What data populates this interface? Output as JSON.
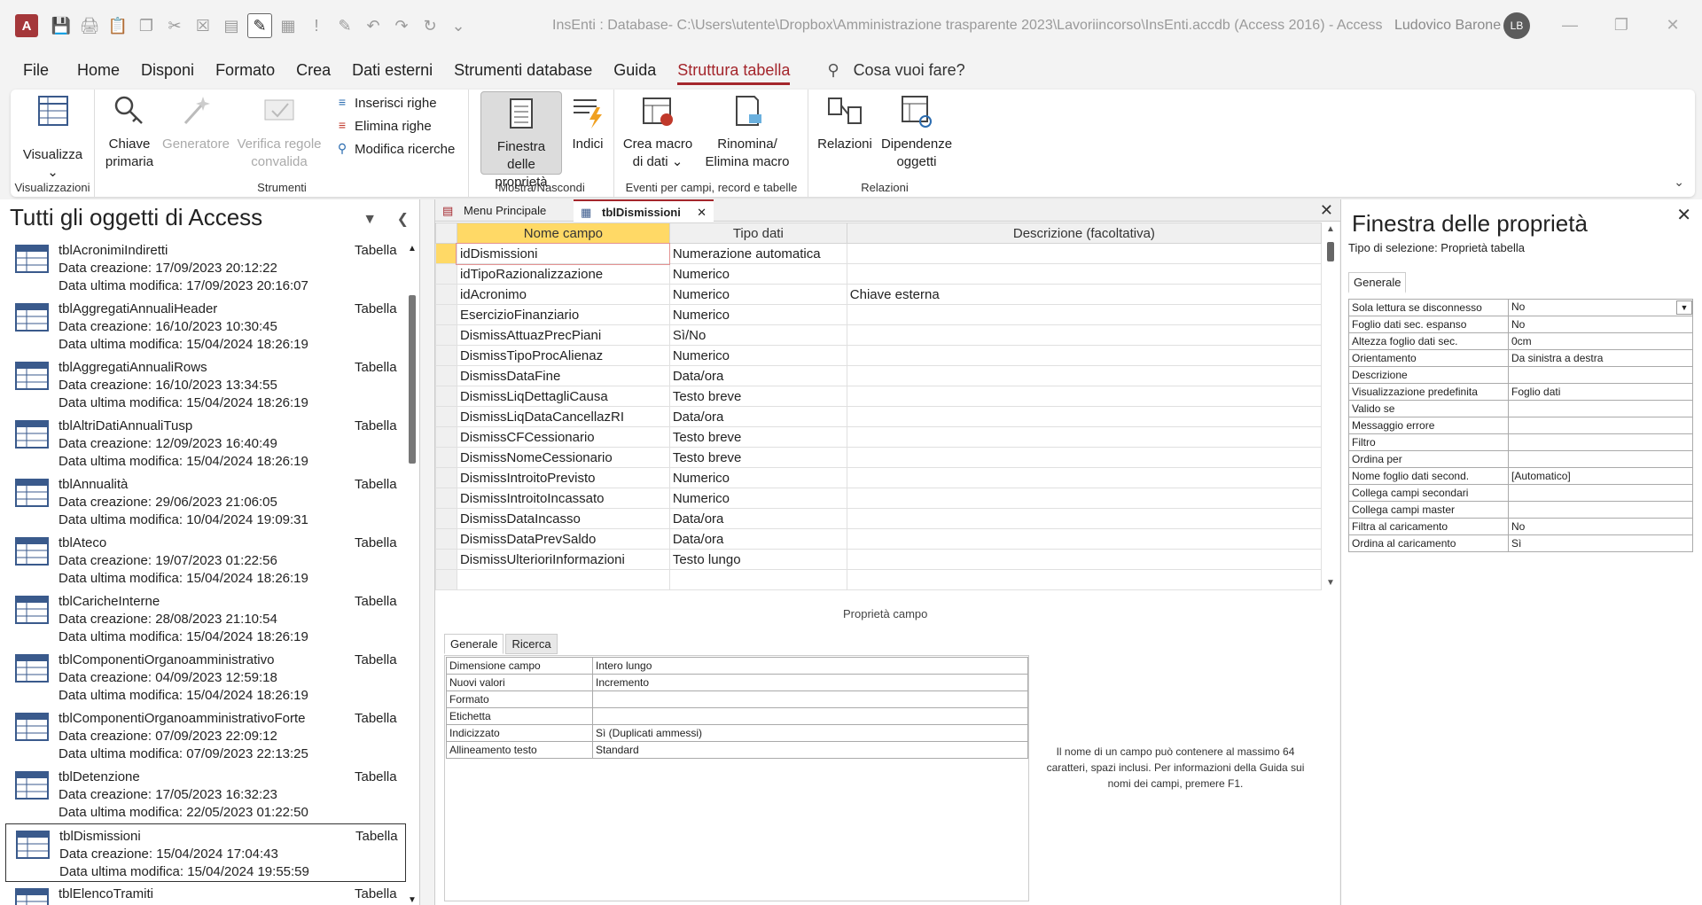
{
  "window": {
    "title": "InsEnti : Database- C:\\Users\\utente\\Dropbox\\Amministrazione trasparente 2023\\Lavoriincorso\\InsEnti.accdb (Access 2016)  -  Access",
    "user": "Ludovico Barone",
    "avatar_initials": "LB",
    "app_logo": "A"
  },
  "menu": {
    "items": [
      "File",
      "Home",
      "Disponi",
      "Formato",
      "Crea",
      "Dati esterni",
      "Strumenti database",
      "Guida",
      "Struttura tabella"
    ],
    "tellme": "Cosa vuoi fare?"
  },
  "ribbon": {
    "visualizza": "Visualizza",
    "visualizzazioni_group": "Visualizzazioni",
    "chiave_l1": "Chiave",
    "chiave_l2": "primaria",
    "generatore": "Generatore",
    "verifica_l1": "Verifica regole",
    "verifica_l2": "convalida",
    "inserisci_righe": "Inserisci righe",
    "elimina_righe": "Elimina righe",
    "modifica_ricerche": "Modifica ricerche",
    "strumenti_group": "Strumenti",
    "finestra_l1": "Finestra delle",
    "finestra_l2": "proprietà",
    "indici": "Indici",
    "mostra_group": "Mostra/Nascondi",
    "crea_macro_l1": "Crea macro",
    "crea_macro_l2": "di dati",
    "rinomina_l1": "Rinomina/",
    "rinomina_l2": "Elimina macro",
    "eventi_group": "Eventi per campi, record e tabelle",
    "relazioni": "Relazioni",
    "dipendenze_l1": "Dipendenze",
    "dipendenze_l2": "oggetti",
    "relazioni_group": "Relazioni"
  },
  "nav": {
    "title": "Tutti gli oggetti di Access",
    "items": [
      {
        "name": "tblAcronimiIndiretti",
        "created": "Data creazione: 17/09/2023 20:12:22",
        "modified": "Data ultima modifica: 17/09/2023 20:16:07",
        "type": "Tabella"
      },
      {
        "name": "tblAggregatiAnnualiHeader",
        "created": "Data creazione: 16/10/2023 10:30:45",
        "modified": "Data ultima modifica: 15/04/2024 18:26:19",
        "type": "Tabella"
      },
      {
        "name": "tblAggregatiAnnualiRows",
        "created": "Data creazione: 16/10/2023 13:34:55",
        "modified": "Data ultima modifica: 15/04/2024 18:26:19",
        "type": "Tabella"
      },
      {
        "name": "tblAltriDatiAnnualiTusp",
        "created": "Data creazione: 12/09/2023 16:40:49",
        "modified": "Data ultima modifica: 15/04/2024 18:26:19",
        "type": "Tabella"
      },
      {
        "name": "tblAnnualità",
        "created": "Data creazione: 29/06/2023 21:06:05",
        "modified": "Data ultima modifica: 10/04/2024 19:09:31",
        "type": "Tabella"
      },
      {
        "name": "tblAteco",
        "created": "Data creazione: 19/07/2023 01:22:56",
        "modified": "Data ultima modifica: 15/04/2024 18:26:19",
        "type": "Tabella"
      },
      {
        "name": "tblCaricheInterne",
        "created": "Data creazione: 28/08/2023 21:10:54",
        "modified": "Data ultima modifica: 15/04/2024 18:26:19",
        "type": "Tabella"
      },
      {
        "name": "tblComponentiOrganoamministrativo",
        "created": "Data creazione: 04/09/2023 12:59:18",
        "modified": "Data ultima modifica: 15/04/2024 18:26:19",
        "type": "Tabella"
      },
      {
        "name": "tblComponentiOrganoamministrativoForte",
        "created": "Data creazione: 07/09/2023 22:09:12",
        "modified": "Data ultima modifica: 07/09/2023 22:13:25",
        "type": "Tabella"
      },
      {
        "name": "tblDetenzione",
        "created": "Data creazione: 17/05/2023 16:32:23",
        "modified": "Data ultima modifica: 22/05/2023 01:22:50",
        "type": "Tabella"
      },
      {
        "name": "tblDismissioni",
        "created": "Data creazione: 15/04/2024 17:04:43",
        "modified": "Data ultima modifica: 15/04/2024 19:55:59",
        "type": "Tabella"
      },
      {
        "name": "tblElencoTramiti",
        "created": "",
        "modified": "",
        "type": "Tabella"
      }
    ]
  },
  "doc": {
    "tabs": [
      "Menu Principale",
      "tblDismissioni"
    ],
    "headers": [
      "Nome campo",
      "Tipo dati",
      "Descrizione (facoltativa)"
    ],
    "rows": [
      [
        "idDismissioni",
        "Numerazione automatica",
        ""
      ],
      [
        "idTipoRazionalizzazione",
        "Numerico",
        ""
      ],
      [
        "idAcronimo",
        "Numerico",
        "Chiave esterna"
      ],
      [
        "EsercizioFinanziario",
        "Numerico",
        ""
      ],
      [
        "DismissAttuazPrecPiani",
        "Sì/No",
        ""
      ],
      [
        "DismissTipoProcAlienaz",
        "Numerico",
        ""
      ],
      [
        "DismissDataFine",
        "Data/ora",
        ""
      ],
      [
        "DismissLiqDettagliCausa",
        "Testo breve",
        ""
      ],
      [
        "DismissLiqDataCancellazRI",
        "Data/ora",
        ""
      ],
      [
        "DismissCFCessionario",
        "Testo breve",
        ""
      ],
      [
        "DismissNomeCessionario",
        "Testo breve",
        ""
      ],
      [
        "DismissIntroitoPrevisto",
        "Numerico",
        ""
      ],
      [
        "DismissIntroitoIncassato",
        "Numerico",
        ""
      ],
      [
        "DismissDataIncasso",
        "Data/ora",
        ""
      ],
      [
        "DismissDataPrevSaldo",
        "Data/ora",
        ""
      ],
      [
        "DismissUlterioriInformazioni",
        "Testo lungo",
        ""
      ]
    ],
    "field_props_label": "Proprietà campo",
    "field_tabs": [
      "Generale",
      "Ricerca"
    ],
    "field_props": [
      [
        "Dimensione campo",
        "Intero lungo"
      ],
      [
        "Nuovi valori",
        "Incremento"
      ],
      [
        "Formato",
        ""
      ],
      [
        "Etichetta",
        ""
      ],
      [
        "Indicizzato",
        "Sì (Duplicati ammessi)"
      ],
      [
        "Allineamento testo",
        "Standard"
      ]
    ],
    "help": "Il nome di un campo può contenere al massimo 64 caratteri, spazi inclusi. Per informazioni della Guida sui nomi dei campi, premere F1."
  },
  "props": {
    "title": "Finestra delle proprietà",
    "selection": "Tipo di selezione:  Proprietà tabella",
    "tab": "Generale",
    "rows": [
      [
        "Sola lettura se disconnesso",
        "No"
      ],
      [
        "Foglio dati sec. espanso",
        "No"
      ],
      [
        "Altezza foglio dati sec.",
        "0cm"
      ],
      [
        "Orientamento",
        "Da sinistra a destra"
      ],
      [
        "Descrizione",
        ""
      ],
      [
        "Visualizzazione predefinita",
        "Foglio dati"
      ],
      [
        "Valido se",
        ""
      ],
      [
        "Messaggio errore",
        ""
      ],
      [
        "Filtro",
        ""
      ],
      [
        "Ordina per",
        ""
      ],
      [
        "Nome foglio dati second.",
        "[Automatico]"
      ],
      [
        "Collega campi secondari",
        ""
      ],
      [
        "Collega campi master",
        ""
      ],
      [
        "Filtra al caricamento",
        "No"
      ],
      [
        "Ordina al caricamento",
        "Sì"
      ]
    ]
  },
  "colors": {
    "accent": "#a4262c",
    "selection": "#ffd966",
    "logo": "#a4373a"
  }
}
